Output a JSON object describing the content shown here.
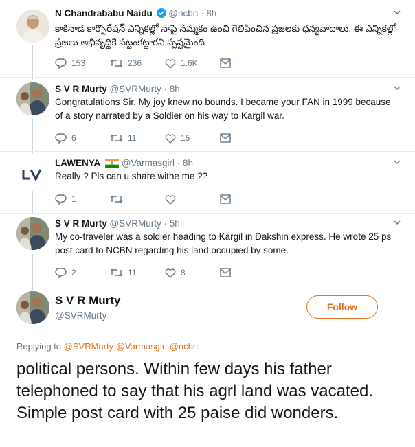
{
  "tweets": [
    {
      "name": "N Chandrababu Naidu",
      "handle": "@ncbn",
      "time": "· 8h",
      "verified": true,
      "text": "కాకినాడ కార్పొరేషన్ ఎన్నికల్లో నాపై నమ్మకం ఉంచి గెలిపించిన ప్రజలకు ధన్యవాదాలు. ఈ ఎన్నికల్లో ప్రజలు అభివృద్ధికే పట్టంకట్టారని స్పష్టమైంది",
      "replies": "153",
      "retweets": "236",
      "likes": "1.6K",
      "icons": [
        "reply-icon",
        "retweet-icon",
        "like-icon",
        "message-icon"
      ]
    },
    {
      "name": "S V R Murty",
      "handle": "@SVRMurty",
      "time": "· 8h",
      "text": "Congratulations Sir. My joy knew no bounds. I became your FAN in 1999 because of a story narrated by a Soldier on his way to Kargil war.",
      "replies": "6",
      "retweets": "11",
      "likes": "15"
    },
    {
      "name": "LAWENYA",
      "flag": "india-flag-icon",
      "handle": "@Varmasgirl",
      "time": "· 8h",
      "text": "Really ? Pls can u share withe me ??",
      "replies": "1",
      "retweets": "",
      "likes": ""
    },
    {
      "name": "S V R Murty",
      "handle": "@SVRMurty",
      "time": "· 5h",
      "text": "My co-traveler was a soldier heading to Kargil in Dakshin express. He wrote 25 ps post card to NCBN regarding his land occupied by some.",
      "replies": "2",
      "retweets": "11",
      "likes": "8"
    }
  ],
  "main": {
    "name": "S V R Murty",
    "handle": "@SVRMurty",
    "follow_label": "Follow",
    "replying_prefix": "Replying to",
    "replying_to": "@SVRMurty @Varmasgirl @ncbn",
    "text": "political persons. Within few days his father telephoned to say that his agrl land was vacated. Simple post card with 25 paise did wonders."
  },
  "colors": {
    "accent": "#e8701a",
    "muted": "#657786",
    "verified": "#1da1f2"
  }
}
